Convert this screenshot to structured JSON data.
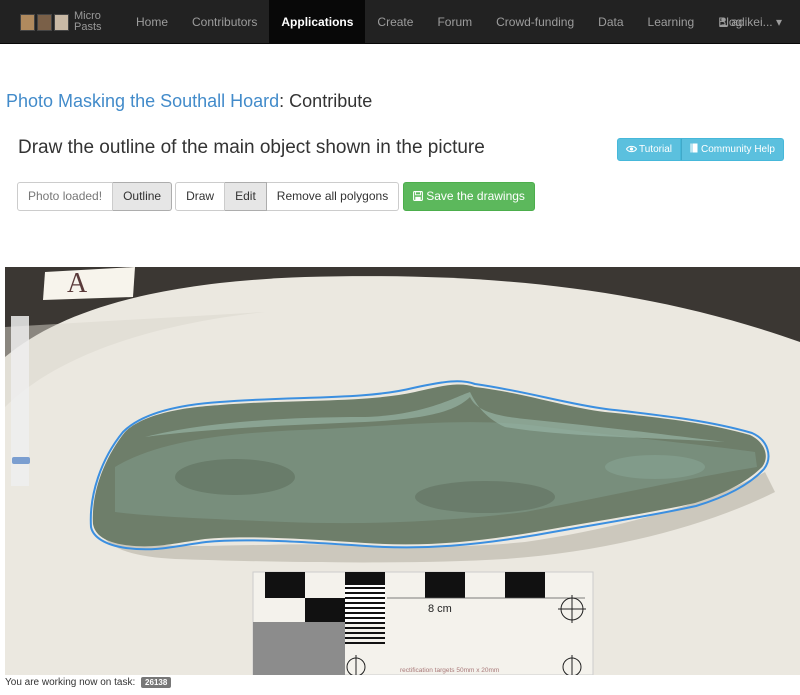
{
  "brand": {
    "text_line1": "Micro",
    "text_line2": "Pasts"
  },
  "nav": {
    "items": [
      {
        "label": "Home",
        "active": false
      },
      {
        "label": "Contributors",
        "active": false
      },
      {
        "label": "Applications",
        "active": true
      },
      {
        "label": "Create",
        "active": false
      },
      {
        "label": "Forum",
        "active": false
      },
      {
        "label": "Crowd-funding",
        "active": false
      },
      {
        "label": "Data",
        "active": false
      },
      {
        "label": "Learning",
        "active": false
      },
      {
        "label": "Blog",
        "active": false
      }
    ],
    "user": "adikei... ▾"
  },
  "page": {
    "project_link": "Photo Masking the Southall Hoard",
    "title_suffix": ": Contribute",
    "task_heading": "Draw the outline of the main object shown in the picture"
  },
  "help": {
    "tutorial": "Tutorial",
    "community_help": "Community Help"
  },
  "toolbar": {
    "photo_loaded": "Photo loaded!",
    "outline": "Outline",
    "draw": "Draw",
    "edit": "Edit",
    "remove_all": "Remove all polygons",
    "save": "Save the drawings"
  },
  "photo": {
    "scale_label": "8 cm",
    "rectification_text": "rectification targets 50mm x 20mm",
    "card_letter": "A"
  },
  "status": {
    "text": "You are working now on task:",
    "task_id": "26138"
  },
  "colors": {
    "accent": "#428bca",
    "info": "#5bc0de",
    "success": "#5cb85c",
    "navbar": "#222222",
    "outline": "#3b8fe0"
  }
}
